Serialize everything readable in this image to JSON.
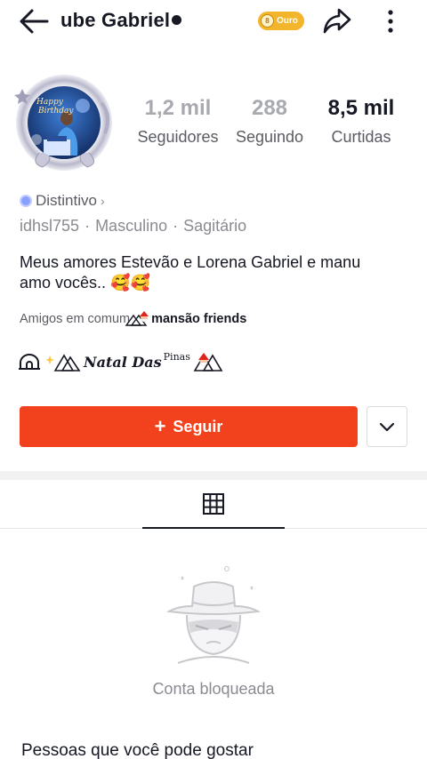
{
  "header": {
    "title": "ube Gabriel",
    "badge_label": "Ouro"
  },
  "profile": {
    "avatar_text_line1": "Happy",
    "avatar_text_line2": "Birthday",
    "stats": [
      {
        "value": "1,2 mil",
        "label": "Seguidores"
      },
      {
        "value": "288",
        "label": "Seguindo"
      },
      {
        "value": "8,5 mil",
        "label": "Curtidas"
      }
    ],
    "distintivo": "Distintivo",
    "username": "idhsl755",
    "gender": "Masculino",
    "sign": "Sagitário",
    "bio_line1": "Meus amores Estevão e Lorena Gabriel e manu",
    "bio_line2": "amo vocês..",
    "bio_emoji": "🥰🥰",
    "friends_prefix": "Amigos em comum",
    "friends_group": "mansão friends",
    "group_name": "Natal Das",
    "group_suffix": "Pinas"
  },
  "actions": {
    "follow_label": "Seguir"
  },
  "content": {
    "blocked_label": "Conta bloqueada",
    "suggest_title": "Pessoas que você pode gostar"
  },
  "colors": {
    "accent": "#f2421d",
    "badge": "#f3b52b"
  }
}
